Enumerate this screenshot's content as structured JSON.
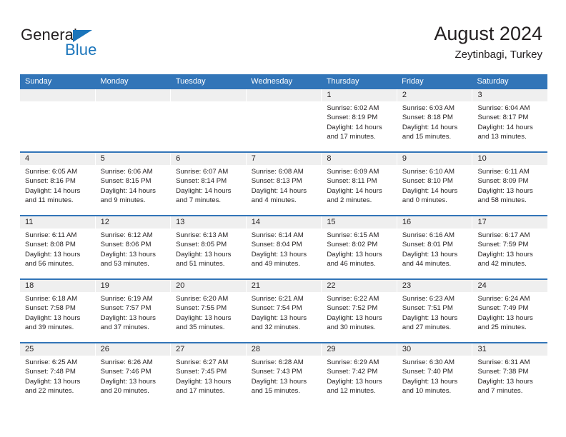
{
  "brand": {
    "name_top": "General",
    "name_bottom": "Blue",
    "accent_color": "#1b75bb"
  },
  "header": {
    "month_title": "August 2024",
    "location": "Zeytinbagi, Turkey"
  },
  "theme": {
    "header_blue": "#3275b8",
    "day_band_gray": "#efefef",
    "text_color": "#231f20"
  },
  "weekdays": [
    "Sunday",
    "Monday",
    "Tuesday",
    "Wednesday",
    "Thursday",
    "Friday",
    "Saturday"
  ],
  "weeks": [
    [
      {
        "day": "",
        "empty": true,
        "sunrise": "",
        "sunset": "",
        "daylight_1": "",
        "daylight_2": ""
      },
      {
        "day": "",
        "empty": true,
        "sunrise": "",
        "sunset": "",
        "daylight_1": "",
        "daylight_2": ""
      },
      {
        "day": "",
        "empty": true,
        "sunrise": "",
        "sunset": "",
        "daylight_1": "",
        "daylight_2": ""
      },
      {
        "day": "",
        "empty": true,
        "sunrise": "",
        "sunset": "",
        "daylight_1": "",
        "daylight_2": ""
      },
      {
        "day": "1",
        "sunrise": "Sunrise: 6:02 AM",
        "sunset": "Sunset: 8:19 PM",
        "daylight_1": "Daylight: 14 hours",
        "daylight_2": "and 17 minutes."
      },
      {
        "day": "2",
        "sunrise": "Sunrise: 6:03 AM",
        "sunset": "Sunset: 8:18 PM",
        "daylight_1": "Daylight: 14 hours",
        "daylight_2": "and 15 minutes."
      },
      {
        "day": "3",
        "sunrise": "Sunrise: 6:04 AM",
        "sunset": "Sunset: 8:17 PM",
        "daylight_1": "Daylight: 14 hours",
        "daylight_2": "and 13 minutes."
      }
    ],
    [
      {
        "day": "4",
        "sunrise": "Sunrise: 6:05 AM",
        "sunset": "Sunset: 8:16 PM",
        "daylight_1": "Daylight: 14 hours",
        "daylight_2": "and 11 minutes."
      },
      {
        "day": "5",
        "sunrise": "Sunrise: 6:06 AM",
        "sunset": "Sunset: 8:15 PM",
        "daylight_1": "Daylight: 14 hours",
        "daylight_2": "and 9 minutes."
      },
      {
        "day": "6",
        "sunrise": "Sunrise: 6:07 AM",
        "sunset": "Sunset: 8:14 PM",
        "daylight_1": "Daylight: 14 hours",
        "daylight_2": "and 7 minutes."
      },
      {
        "day": "7",
        "sunrise": "Sunrise: 6:08 AM",
        "sunset": "Sunset: 8:13 PM",
        "daylight_1": "Daylight: 14 hours",
        "daylight_2": "and 4 minutes."
      },
      {
        "day": "8",
        "sunrise": "Sunrise: 6:09 AM",
        "sunset": "Sunset: 8:11 PM",
        "daylight_1": "Daylight: 14 hours",
        "daylight_2": "and 2 minutes."
      },
      {
        "day": "9",
        "sunrise": "Sunrise: 6:10 AM",
        "sunset": "Sunset: 8:10 PM",
        "daylight_1": "Daylight: 14 hours",
        "daylight_2": "and 0 minutes."
      },
      {
        "day": "10",
        "sunrise": "Sunrise: 6:11 AM",
        "sunset": "Sunset: 8:09 PM",
        "daylight_1": "Daylight: 13 hours",
        "daylight_2": "and 58 minutes."
      }
    ],
    [
      {
        "day": "11",
        "sunrise": "Sunrise: 6:11 AM",
        "sunset": "Sunset: 8:08 PM",
        "daylight_1": "Daylight: 13 hours",
        "daylight_2": "and 56 minutes."
      },
      {
        "day": "12",
        "sunrise": "Sunrise: 6:12 AM",
        "sunset": "Sunset: 8:06 PM",
        "daylight_1": "Daylight: 13 hours",
        "daylight_2": "and 53 minutes."
      },
      {
        "day": "13",
        "sunrise": "Sunrise: 6:13 AM",
        "sunset": "Sunset: 8:05 PM",
        "daylight_1": "Daylight: 13 hours",
        "daylight_2": "and 51 minutes."
      },
      {
        "day": "14",
        "sunrise": "Sunrise: 6:14 AM",
        "sunset": "Sunset: 8:04 PM",
        "daylight_1": "Daylight: 13 hours",
        "daylight_2": "and 49 minutes."
      },
      {
        "day": "15",
        "sunrise": "Sunrise: 6:15 AM",
        "sunset": "Sunset: 8:02 PM",
        "daylight_1": "Daylight: 13 hours",
        "daylight_2": "and 46 minutes."
      },
      {
        "day": "16",
        "sunrise": "Sunrise: 6:16 AM",
        "sunset": "Sunset: 8:01 PM",
        "daylight_1": "Daylight: 13 hours",
        "daylight_2": "and 44 minutes."
      },
      {
        "day": "17",
        "sunrise": "Sunrise: 6:17 AM",
        "sunset": "Sunset: 7:59 PM",
        "daylight_1": "Daylight: 13 hours",
        "daylight_2": "and 42 minutes."
      }
    ],
    [
      {
        "day": "18",
        "sunrise": "Sunrise: 6:18 AM",
        "sunset": "Sunset: 7:58 PM",
        "daylight_1": "Daylight: 13 hours",
        "daylight_2": "and 39 minutes."
      },
      {
        "day": "19",
        "sunrise": "Sunrise: 6:19 AM",
        "sunset": "Sunset: 7:57 PM",
        "daylight_1": "Daylight: 13 hours",
        "daylight_2": "and 37 minutes."
      },
      {
        "day": "20",
        "sunrise": "Sunrise: 6:20 AM",
        "sunset": "Sunset: 7:55 PM",
        "daylight_1": "Daylight: 13 hours",
        "daylight_2": "and 35 minutes."
      },
      {
        "day": "21",
        "sunrise": "Sunrise: 6:21 AM",
        "sunset": "Sunset: 7:54 PM",
        "daylight_1": "Daylight: 13 hours",
        "daylight_2": "and 32 minutes."
      },
      {
        "day": "22",
        "sunrise": "Sunrise: 6:22 AM",
        "sunset": "Sunset: 7:52 PM",
        "daylight_1": "Daylight: 13 hours",
        "daylight_2": "and 30 minutes."
      },
      {
        "day": "23",
        "sunrise": "Sunrise: 6:23 AM",
        "sunset": "Sunset: 7:51 PM",
        "daylight_1": "Daylight: 13 hours",
        "daylight_2": "and 27 minutes."
      },
      {
        "day": "24",
        "sunrise": "Sunrise: 6:24 AM",
        "sunset": "Sunset: 7:49 PM",
        "daylight_1": "Daylight: 13 hours",
        "daylight_2": "and 25 minutes."
      }
    ],
    [
      {
        "day": "25",
        "sunrise": "Sunrise: 6:25 AM",
        "sunset": "Sunset: 7:48 PM",
        "daylight_1": "Daylight: 13 hours",
        "daylight_2": "and 22 minutes."
      },
      {
        "day": "26",
        "sunrise": "Sunrise: 6:26 AM",
        "sunset": "Sunset: 7:46 PM",
        "daylight_1": "Daylight: 13 hours",
        "daylight_2": "and 20 minutes."
      },
      {
        "day": "27",
        "sunrise": "Sunrise: 6:27 AM",
        "sunset": "Sunset: 7:45 PM",
        "daylight_1": "Daylight: 13 hours",
        "daylight_2": "and 17 minutes."
      },
      {
        "day": "28",
        "sunrise": "Sunrise: 6:28 AM",
        "sunset": "Sunset: 7:43 PM",
        "daylight_1": "Daylight: 13 hours",
        "daylight_2": "and 15 minutes."
      },
      {
        "day": "29",
        "sunrise": "Sunrise: 6:29 AM",
        "sunset": "Sunset: 7:42 PM",
        "daylight_1": "Daylight: 13 hours",
        "daylight_2": "and 12 minutes."
      },
      {
        "day": "30",
        "sunrise": "Sunrise: 6:30 AM",
        "sunset": "Sunset: 7:40 PM",
        "daylight_1": "Daylight: 13 hours",
        "daylight_2": "and 10 minutes."
      },
      {
        "day": "31",
        "sunrise": "Sunrise: 6:31 AM",
        "sunset": "Sunset: 7:38 PM",
        "daylight_1": "Daylight: 13 hours",
        "daylight_2": "and 7 minutes."
      }
    ]
  ]
}
